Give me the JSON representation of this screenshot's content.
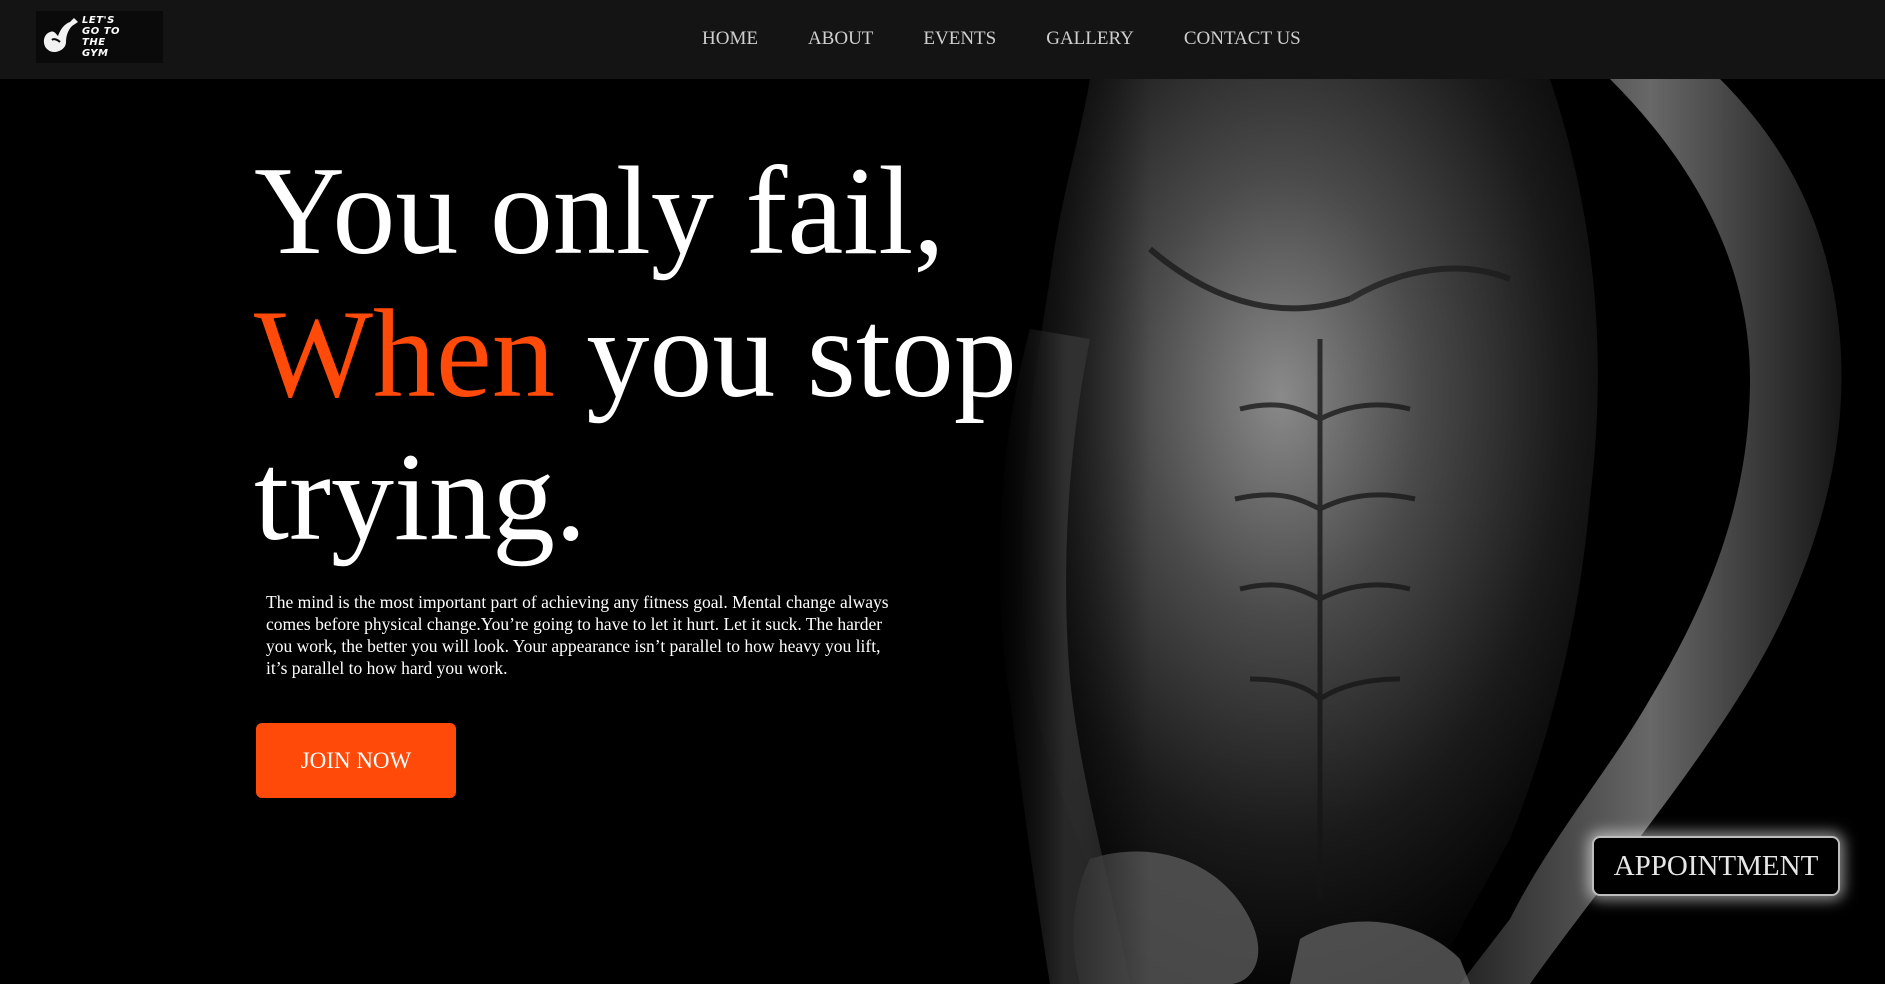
{
  "logo": {
    "text": "LET'S\nGO TO\nTHE\nGYM",
    "icon": "flexed-arm-icon"
  },
  "nav": {
    "items": [
      {
        "label": "HOME"
      },
      {
        "label": "ABOUT"
      },
      {
        "label": "EVENTS"
      },
      {
        "label": "GALLERY"
      },
      {
        "label": "CONTACT US"
      }
    ]
  },
  "hero": {
    "line1": "You only fail,",
    "line2_accent": "When",
    "line2_rest": " you stop",
    "line3": "trying.",
    "description": "The mind is the most important part of achieving any fitness goal. Mental change always comes before physical change.You’re going to have to let it hurt. Let it suck. The harder you work, the better you will look. Your appearance isn’t parallel to how heavy you lift, it’s parallel to how hard you work.",
    "join_label": "JOIN NOW",
    "appointment_label": "APPOINTMENT"
  },
  "colors": {
    "accent": "#ff4a0a",
    "background": "#000000",
    "navbar": "#141414"
  }
}
